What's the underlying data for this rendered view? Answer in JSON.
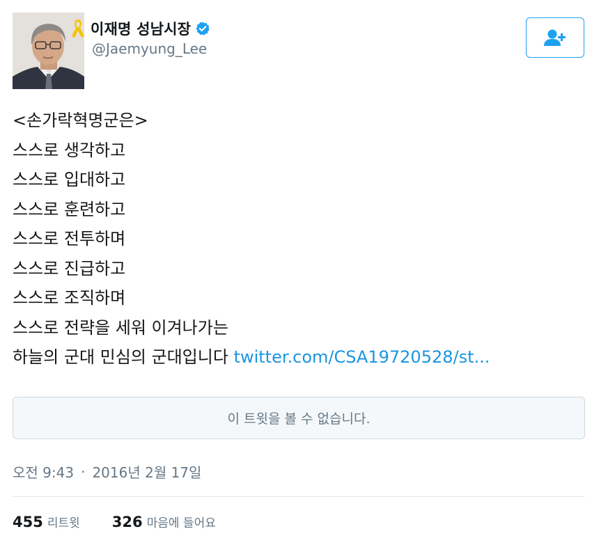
{
  "user": {
    "display_name": "이재명 성남시장",
    "handle": "@Jaemyung_Lee"
  },
  "tweet": {
    "lines": [
      "<손가락혁명군은>",
      "스스로 생각하고",
      "스스로 입대하고",
      "스스로 훈련하고",
      "스스로 전투하며",
      "스스로 진급하고",
      "스스로 조직하며",
      "스스로 전략을 세워 이겨나가는"
    ],
    "last_line_text": "하늘의 군대 민심의 군대입니다 ",
    "link_text": "twitter.com/CSA19720528/st..."
  },
  "quote_card": {
    "message": "이 트윗을 볼 수 없습니다."
  },
  "timestamp": {
    "time": "오전 9:43",
    "separator": "·",
    "date": "2016년 2월 17일"
  },
  "stats": {
    "retweets_count": "455",
    "retweets_label": "리트윗",
    "likes_count": "326",
    "likes_label": "마음에 들어요"
  },
  "icons": {
    "ribbon": "yellow-ribbon-icon",
    "verified": "verified-badge-icon",
    "follow": "follow-user-icon"
  },
  "colors": {
    "accent": "#1da1f2",
    "link": "#1b95e0",
    "secondary_text": "#657786",
    "ribbon": "#f5c400"
  }
}
